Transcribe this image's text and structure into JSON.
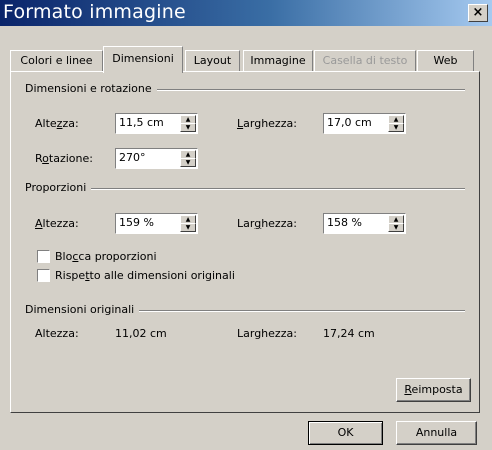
{
  "window": {
    "title": "Formato immagine",
    "close_glyph": "×"
  },
  "tabs": [
    {
      "label": "Colori e linee",
      "state": "normal"
    },
    {
      "label": "Dimensioni",
      "state": "active"
    },
    {
      "label": "Layout",
      "state": "normal"
    },
    {
      "label": "Immagine",
      "state": "normal"
    },
    {
      "label": "Casella di testo",
      "state": "disabled"
    },
    {
      "label": "Web",
      "state": "normal"
    }
  ],
  "size_rotation": {
    "header": "Dimensioni e rotazione",
    "height_label": {
      "pre": "Alte",
      "key": "z",
      "post": "za:"
    },
    "height_value": "11,5 cm",
    "width_label": {
      "pre": "",
      "key": "L",
      "post": "arghezza:"
    },
    "width_value": "17,0 cm",
    "rotation_label": {
      "pre": "R",
      "key": "o",
      "post": "tazione:"
    },
    "rotation_value": "270°"
  },
  "scale": {
    "header": "Proporzioni",
    "height_label": {
      "pre": "",
      "key": "A",
      "post": "ltezza:"
    },
    "height_value": "159 %",
    "width_label": {
      "pre": "Lar",
      "key": "g",
      "post": "hezza:"
    },
    "width_value": "158 %",
    "lock_label": {
      "pre": "Blo",
      "key": "c",
      "post": "ca proporzioni"
    },
    "lock_checked": false,
    "relative_label": {
      "pre": "Rispe",
      "key": "t",
      "post": "to alle dimensioni originali"
    },
    "relative_checked": false
  },
  "original": {
    "header": "Dimensioni originali",
    "height_label": "Altezza:",
    "height_value": "11,02 cm",
    "width_label": "Larghezza:",
    "width_value": "17,24 cm"
  },
  "buttons": {
    "reset": {
      "pre": "",
      "key": "R",
      "post": "eimposta"
    },
    "ok": "OK",
    "cancel": "Annulla"
  },
  "icons": {
    "spin_up": "triangle-up",
    "spin_down": "triangle-down"
  }
}
